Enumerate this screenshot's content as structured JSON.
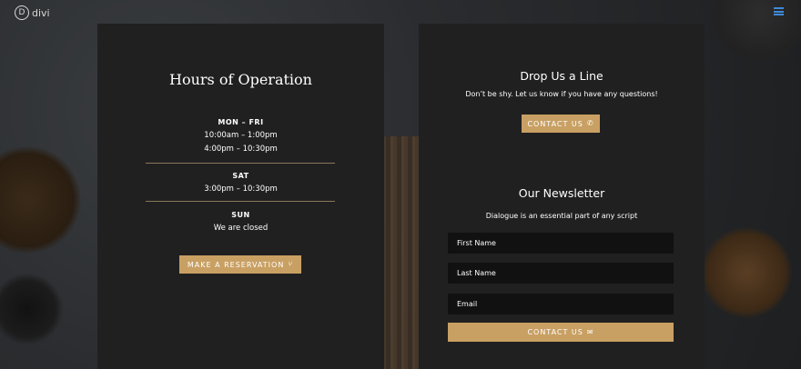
{
  "brand": {
    "logo_letter": "D",
    "logo_text": "divi"
  },
  "hours": {
    "title": "Hours of Operation",
    "groups": [
      {
        "day": "MON – FRI",
        "lines": [
          "10:00am – 1:00pm",
          "4:00pm – 10:30pm"
        ]
      },
      {
        "day": "SAT",
        "lines": [
          "3:00pm – 10:30pm"
        ]
      },
      {
        "day": "SUN",
        "lines": [
          "We are closed"
        ]
      }
    ],
    "reservation_button": "MAKE A RESERVATION"
  },
  "contact": {
    "title": "Drop Us a Line",
    "text": "Don’t be shy. Let us know if you have any questions!",
    "button": "CONTACT US"
  },
  "newsletter": {
    "title": "Our Newsletter",
    "text": "Dialogue is an essential part of any script",
    "fields": [
      "First Name",
      "Last Name",
      "Email"
    ],
    "button": "CONTACT US"
  },
  "colors": {
    "accent": "#c9a063",
    "card": "#202020",
    "menu_icon": "#3e8ad9"
  },
  "icons": {
    "menu": "hamburger-icon",
    "reservation": "restaurant-icon",
    "contact": "phone-icon",
    "newsletter": "envelope-icon"
  }
}
